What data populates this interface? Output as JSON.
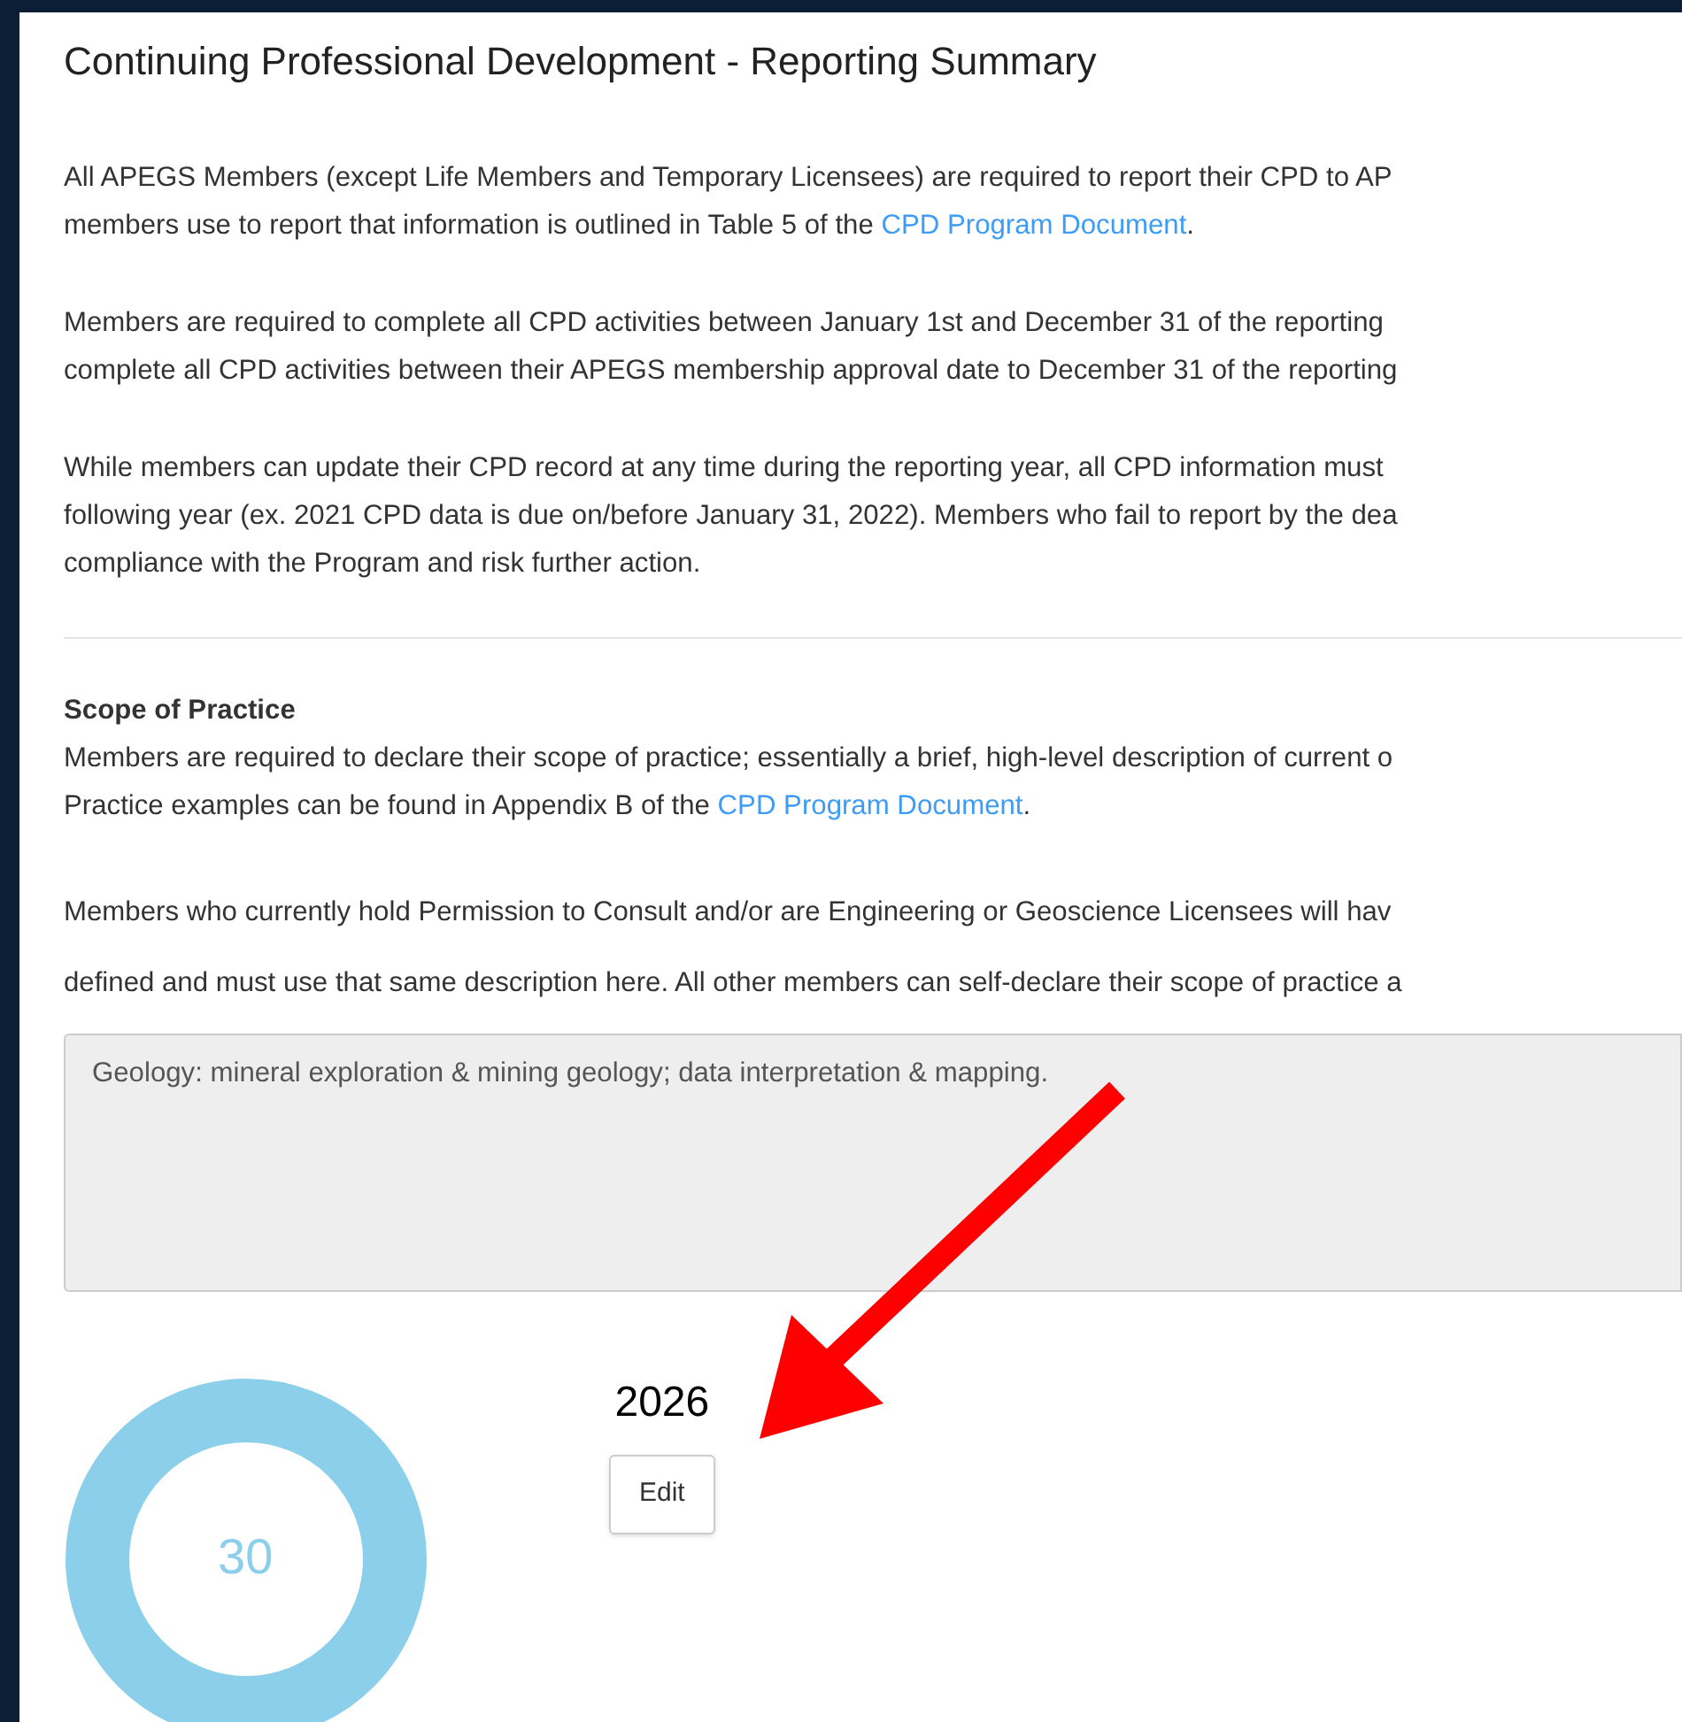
{
  "title": "Continuing Professional Development - Reporting Summary",
  "intro": [
    {
      "lines": [
        [
          {
            "kind": "text",
            "text": "All APEGS Members (except Life Members and Temporary Licensees) are required to report their CPD to AP"
          }
        ],
        [
          {
            "kind": "text",
            "text": "members use to report that information is outlined in Table 5 of the "
          },
          {
            "kind": "link",
            "text": "CPD Program Document"
          },
          {
            "kind": "text",
            "text": "."
          }
        ]
      ]
    },
    {
      "lines": [
        [
          {
            "kind": "text",
            "text": "Members are required to complete all CPD activities between January 1st and December 31 of the reporting"
          }
        ],
        [
          {
            "kind": "text",
            "text": "complete all CPD activities between their APEGS membership approval date to December 31 of the reporting"
          }
        ]
      ]
    },
    {
      "lines": [
        [
          {
            "kind": "text",
            "text": "While members can update their CPD record at any time during the reporting year, all CPD information must"
          }
        ],
        [
          {
            "kind": "text",
            "text": "following year (ex. 2021 CPD data is due on/before January 31, 2022). Members who fail to report by the dea"
          }
        ],
        [
          {
            "kind": "text",
            "text": "compliance with the Program and risk further action."
          }
        ]
      ]
    }
  ],
  "scope": {
    "heading": "Scope of Practice",
    "lines": [
      [
        {
          "kind": "text",
          "text": "Members are required to declare their scope of practice; essentially a brief, high-level description of current o"
        }
      ],
      [
        {
          "kind": "text",
          "text": "Practice examples can be found in Appendix B of the "
        },
        {
          "kind": "link",
          "text": "CPD Program Document"
        },
        {
          "kind": "text",
          "text": "."
        }
      ]
    ],
    "note_lines": [
      [
        {
          "kind": "text",
          "text": "Members who currently hold Permission to Consult and/or are Engineering or Geoscience Licensees will hav"
        }
      ],
      [
        {
          "kind": "text",
          "text": "defined and must use that same description here. All other members can self-declare their scope of practice a"
        }
      ]
    ],
    "value": "Geology: mineral exploration & mining geology; data interpretation & mapping."
  },
  "summary": {
    "total": "30",
    "year": "2026",
    "edit_button": "Edit"
  }
}
